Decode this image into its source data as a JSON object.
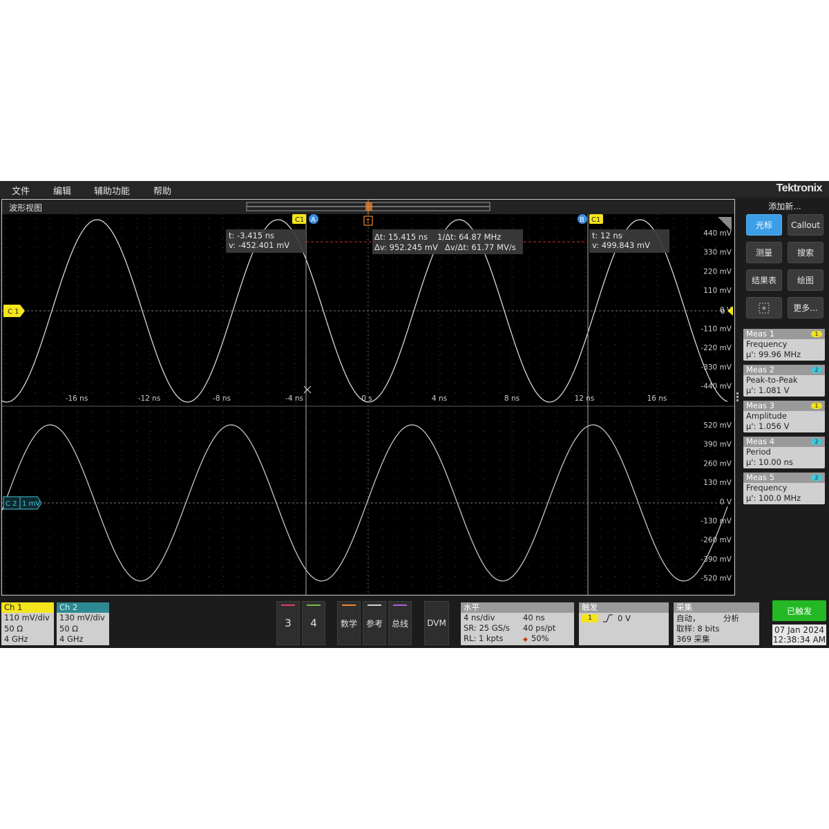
{
  "menu": [
    "文件",
    "编辑",
    "辅助功能",
    "帮助"
  ],
  "brand": "Tektronix",
  "waveform_view": {
    "title": "波形视图",
    "ch1_marker": "C 1",
    "ch2_marker": "C 2",
    "ch2_marker_value": "1 mV",
    "zero_marker": "0",
    "trigger_marker": "T",
    "time_axis_labels": [
      "-16 ns",
      "-12 ns",
      "-8 ns",
      "-4 ns",
      "0 s",
      "4 ns",
      "8 ns",
      "12 ns",
      "16 ns"
    ],
    "upper_volt_labels": [
      "440 mV",
      "330 mV",
      "220 mV",
      "110 mV",
      "0 V",
      "-110 mV",
      "-220 mV",
      "-330 mV",
      "-440 mV"
    ],
    "lower_volt_labels": [
      "520 mV",
      "390 mV",
      "260 mV",
      "130 mV",
      "0 V",
      "-130 mV",
      "-260 mV",
      "-390 mV",
      "-520 mV"
    ],
    "cursor_a": {
      "tag_channel": "C1",
      "tag": "A",
      "t": "t: -3.415 ns",
      "v": "v: -452.401 mV"
    },
    "cursor_b": {
      "tag_channel": "C1",
      "tag": "B",
      "t": "t: 12 ns",
      "v": "v: 499.843 mV"
    },
    "delta": {
      "dt": "Δt: 15.415 ns",
      "inv_dt": "1/Δt: 64.87 MHz",
      "dv": "Δv: 952.245 mV",
      "dv_dt": "Δv/Δt: 61.77 MV/s"
    }
  },
  "right_panel": {
    "add_new": "添加新...",
    "buttons": [
      "光标",
      "Callout",
      "测量",
      "搜索",
      "结果表",
      "绘图",
      "更多..."
    ],
    "measurements": [
      {
        "name": "Meas 1",
        "label": "Frequency",
        "value": "μ': 99.96 MHz",
        "channel": "1",
        "color": "#f0e020"
      },
      {
        "name": "Meas 2",
        "label": "Peak-to-Peak",
        "value": "μ': 1.081 V",
        "channel": "2",
        "color": "#40c8d8"
      },
      {
        "name": "Meas 3",
        "label": "Amplitude",
        "value": "μ': 1.056 V",
        "channel": "1",
        "color": "#f0e020"
      },
      {
        "name": "Meas 4",
        "label": "Period",
        "value": "μ': 10.00 ns",
        "channel": "2",
        "color": "#40c8d8"
      },
      {
        "name": "Meas 5",
        "label": "Frequency",
        "value": "μ': 100.0 MHz",
        "channel": "2",
        "color": "#40c8d8"
      }
    ]
  },
  "bottom": {
    "ch1": {
      "title": "Ch 1",
      "scale": "110 mV/div",
      "impedance": "50 Ω",
      "bandwidth": "4 GHz",
      "color": "#f5e51c"
    },
    "ch2": {
      "title": "Ch 2",
      "scale": "130 mV/div",
      "impedance": "50 Ω",
      "bandwidth": "4 GHz",
      "color": "#2e8a92"
    },
    "buttons": [
      "3",
      "4",
      "数学",
      "参考",
      "总线",
      "DVM"
    ],
    "horizontal": {
      "title": "水平",
      "scale": "4 ns/div",
      "sr": "SR: 25 GS/s",
      "rl": "RL: 1 kpts",
      "position": "40 ns",
      "resolution": "40 ps/pt",
      "trigger_pos": "50%"
    },
    "trigger": {
      "title": "触发",
      "source": "1",
      "level": "0 V"
    },
    "acquisition": {
      "title": "采集",
      "mode": "自动，",
      "analysis": "分析",
      "bits": "取样: 8 bits",
      "count": "369 采集"
    },
    "status": "已触发",
    "date": "07 Jan 2024",
    "time": "12:38:34 AM"
  },
  "colors": {
    "ch1": "#f5e51c",
    "ch2": "#40c8d8",
    "cursor_tag": "#3b8fe0",
    "trigger": "#f08a30"
  }
}
